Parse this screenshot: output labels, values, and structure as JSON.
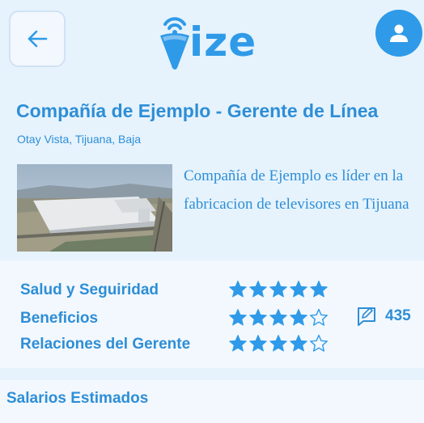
{
  "header": {
    "logo_text": "ize",
    "back_icon": "arrow-left-icon",
    "user_icon": "user-icon"
  },
  "job": {
    "title": "Compañía de Ejemplo - Gerente de Línea",
    "location": "Otay Vista, Tijuana, Baja",
    "description": "Compañía de Ejemplo es líder en la fabricacion de televisores en Tijuana"
  },
  "ratings": [
    {
      "label": "Salud y Seguiridad",
      "stars": 5,
      "max": 5
    },
    {
      "label": "Beneficios",
      "stars": 4,
      "max": 5
    },
    {
      "label": "Relaciones del Gerente",
      "stars": 4,
      "max": 5
    }
  ],
  "reviews": {
    "count": "435",
    "icon": "edit-review-icon"
  },
  "salaries": {
    "title": "Salarios Estimados"
  },
  "colors": {
    "accent": "#2f9ae8",
    "text": "#2e8ed6",
    "background": "#e6f3fd",
    "panel": "#f2f8fe"
  }
}
